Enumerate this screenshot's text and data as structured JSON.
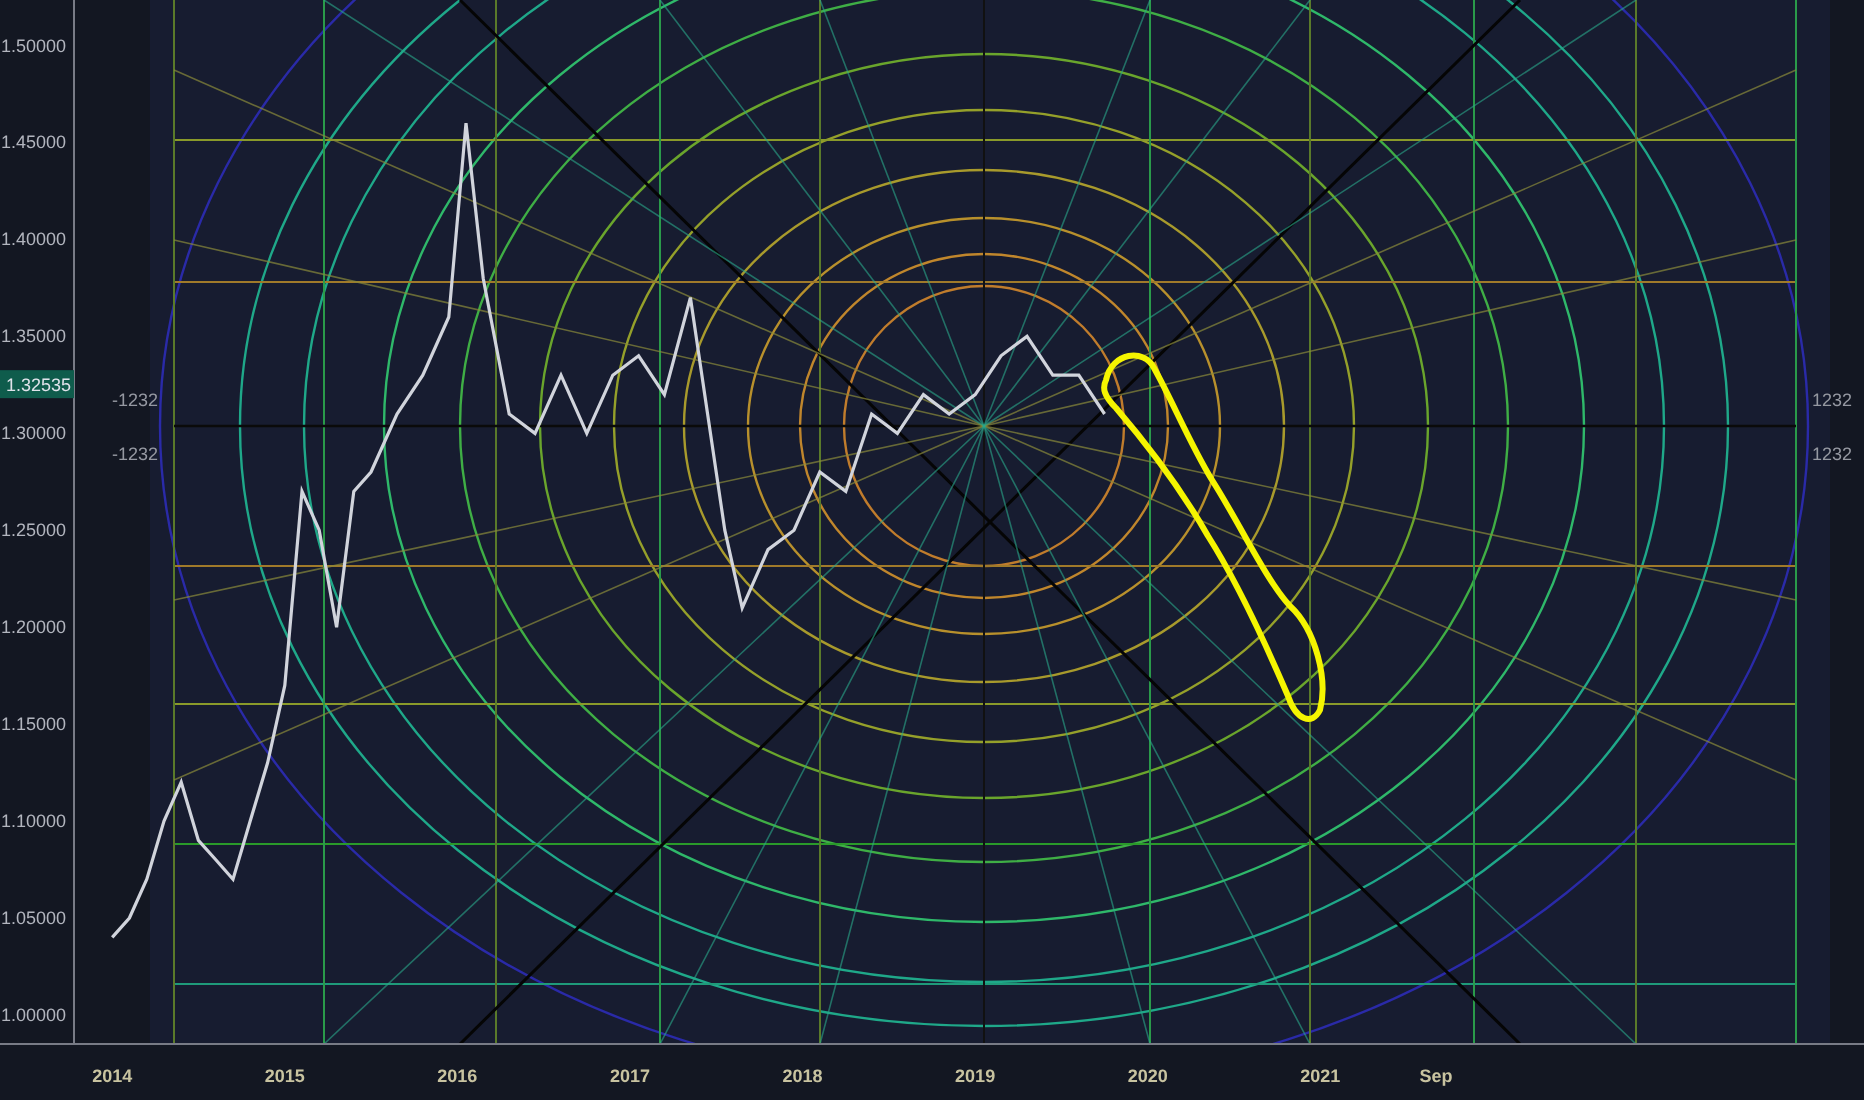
{
  "chart": {
    "chart_data": {
      "type": "line",
      "x": [
        2014.0,
        2014.1,
        2014.2,
        2014.3,
        2014.4,
        2014.5,
        2014.6,
        2014.7,
        2014.8,
        2014.9,
        2015.0,
        2015.1,
        2015.2,
        2015.3,
        2015.4,
        2015.5,
        2015.65,
        2015.8,
        2015.95,
        2016.05,
        2016.15,
        2016.3,
        2016.45,
        2016.6,
        2016.75,
        2016.9,
        2017.05,
        2017.2,
        2017.35,
        2017.45,
        2017.55,
        2017.65,
        2017.8,
        2017.95,
        2018.1,
        2018.25,
        2018.4,
        2018.55,
        2018.7,
        2018.85,
        2019.0,
        2019.15,
        2019.3,
        2019.45,
        2019.6,
        2019.75
      ],
      "series": [
        {
          "color": "#d1d4dc",
          "values": [
            1.04,
            1.05,
            1.07,
            1.1,
            1.12,
            1.09,
            1.08,
            1.07,
            1.1,
            1.13,
            1.17,
            1.27,
            1.25,
            1.2,
            1.27,
            1.28,
            1.31,
            1.33,
            1.36,
            1.46,
            1.38,
            1.31,
            1.3,
            1.33,
            1.3,
            1.33,
            1.34,
            1.32,
            1.37,
            1.31,
            1.25,
            1.21,
            1.24,
            1.25,
            1.28,
            1.27,
            1.31,
            1.3,
            1.32,
            1.31,
            1.32,
            1.34,
            1.35,
            1.33,
            1.33,
            1.31
          ]
        }
      ],
      "xlim": [
        2013.35,
        2024.15
      ],
      "ylim": [
        0.985,
        1.5235
      ],
      "xticks": [
        {
          "value": 2014,
          "label": "2014"
        },
        {
          "value": 2015,
          "label": "2015"
        },
        {
          "value": 2016,
          "label": "2016"
        },
        {
          "value": 2017,
          "label": "2017"
        },
        {
          "value": 2018,
          "label": "2018"
        },
        {
          "value": 2019,
          "label": "2019"
        },
        {
          "value": 2020,
          "label": "2020"
        },
        {
          "value": 2021,
          "label": "2021"
        },
        {
          "value": 2021.67,
          "label": "Sep"
        }
      ],
      "yticks": [
        {
          "value": 1.0,
          "label": "1.00000"
        },
        {
          "value": 1.05,
          "label": "1.05000"
        },
        {
          "value": 1.1,
          "label": "1.10000"
        },
        {
          "value": 1.15,
          "label": "1.15000"
        },
        {
          "value": 1.2,
          "label": "1.20000"
        },
        {
          "value": 1.25,
          "label": "1.25000"
        },
        {
          "value": 1.3,
          "label": "1.30000"
        },
        {
          "value": 1.35,
          "label": "1.35000"
        },
        {
          "value": 1.4,
          "label": "1.40000"
        },
        {
          "value": 1.45,
          "label": "1.45000"
        },
        {
          "value": 1.5,
          "label": "1.50000"
        }
      ]
    },
    "current_price": "1.32535",
    "left_labels": [
      "-1232",
      "-1232"
    ],
    "right_labels": [
      "1232",
      "1232"
    ]
  }
}
